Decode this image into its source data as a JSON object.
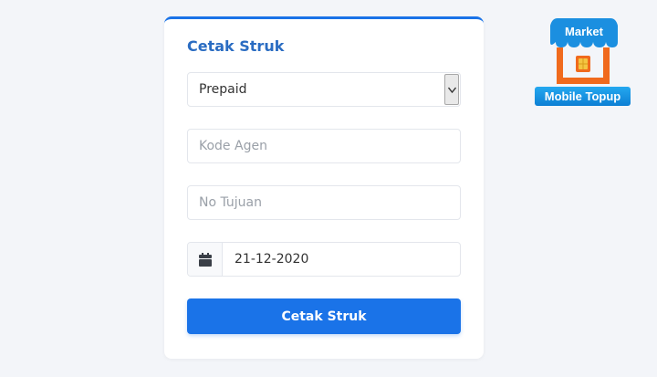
{
  "card": {
    "title": "Cetak Struk",
    "select": {
      "value": "Prepaid"
    },
    "kode_agen": {
      "placeholder": "Kode Agen",
      "value": ""
    },
    "no_tujuan": {
      "placeholder": "No Tujuan",
      "value": ""
    },
    "date": {
      "value": "21-12-2020",
      "icon": "calendar-icon"
    },
    "submit_label": "Cetak Struk"
  },
  "logo": {
    "top_text": "Market",
    "bottom_text": "Mobile Topup",
    "icon": "sim-card-icon"
  },
  "colors": {
    "accent": "#1a73e8",
    "title": "#2a6cc2",
    "logo_orange": "#f06a1d",
    "logo_blue": "#1b8fe0",
    "background": "#f3f5f9"
  }
}
